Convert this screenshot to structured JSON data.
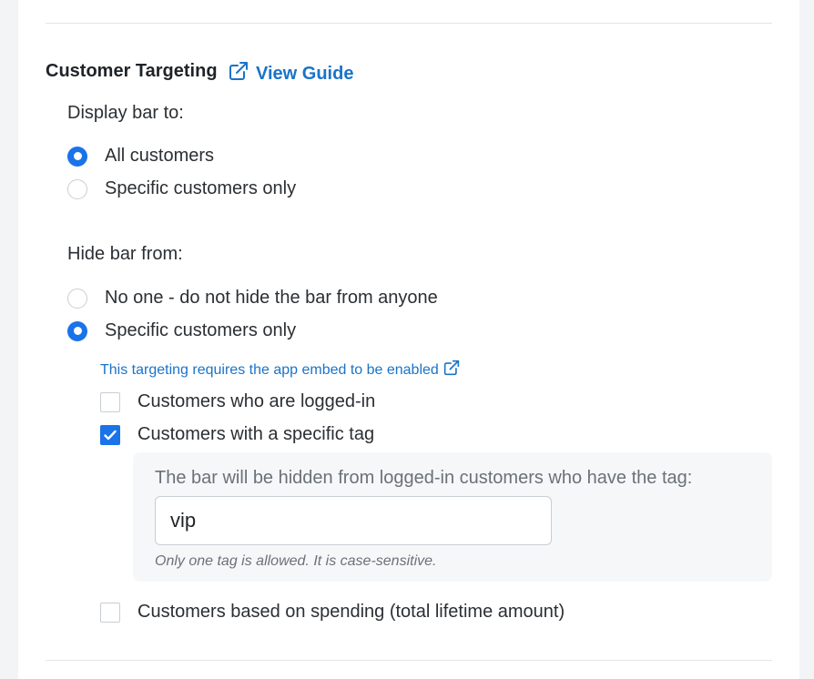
{
  "section": {
    "title": "Customer Targeting",
    "guide_link": "View Guide"
  },
  "display": {
    "label": "Display bar to:",
    "options": [
      {
        "label": "All customers",
        "checked": true
      },
      {
        "label": "Specific customers only",
        "checked": false
      }
    ]
  },
  "hide": {
    "label": "Hide bar from:",
    "options": [
      {
        "label": "No one - do not hide the bar from anyone",
        "checked": false
      },
      {
        "label": "Specific customers only",
        "checked": true
      }
    ],
    "notice": "This targeting requires the app embed to be enabled",
    "checkboxes": [
      {
        "label": "Customers who are logged-in",
        "checked": false
      },
      {
        "label": "Customers with a specific tag",
        "checked": true
      },
      {
        "label": "Customers based on spending (total lifetime amount)",
        "checked": false
      }
    ],
    "tag_panel": {
      "description": "The bar will be hidden from logged-in customers who have the tag:",
      "value": "vip",
      "help": "Only one tag is allowed. It is case-sensitive."
    }
  },
  "colors": {
    "accent": "#1a73e8",
    "link": "#1a73c9"
  }
}
